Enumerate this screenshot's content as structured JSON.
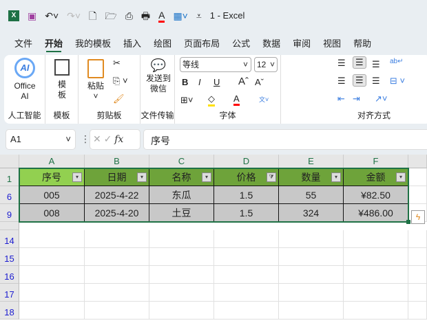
{
  "title": "1  -  Excel",
  "menu_tabs": [
    "文件",
    "开始",
    "我的模板",
    "插入",
    "绘图",
    "页面布局",
    "公式",
    "数据",
    "审阅",
    "视图",
    "帮助"
  ],
  "ribbon": {
    "office_ai": "Office AI",
    "ai_group": "人工智能",
    "template": "模板",
    "template_group": "模板",
    "paste": "粘贴",
    "clipboard_group": "剪贴板",
    "send_wechat": "发送到微信",
    "file_transfer_group": "文件传输",
    "font_name": "等线",
    "font_size": "12",
    "font_group": "字体",
    "bold": "B",
    "italic": "I",
    "underline": "U",
    "align_group": "对齐方式"
  },
  "formula_bar": {
    "name_box": "A1",
    "fx": "fx",
    "value": "序号"
  },
  "columns": [
    "A",
    "B",
    "C",
    "D",
    "E",
    "F"
  ],
  "rows": [
    "1",
    "6",
    "9",
    "14",
    "15",
    "16",
    "17",
    "18"
  ],
  "headers": [
    "序号",
    "日期",
    "名称",
    "价格",
    "数量",
    "金额"
  ],
  "data": [
    [
      "005",
      "2025-4-22",
      "东瓜",
      "1.5",
      "55",
      "¥82.50"
    ],
    [
      "008",
      "2025-4-20",
      "土豆",
      "1.5",
      "324",
      "¥486.00"
    ]
  ],
  "colors": {
    "header_fill": "#6ea33a",
    "header_a1": "#92d050",
    "data_fill": "#c8c8c8",
    "accent": "#1e7145"
  }
}
